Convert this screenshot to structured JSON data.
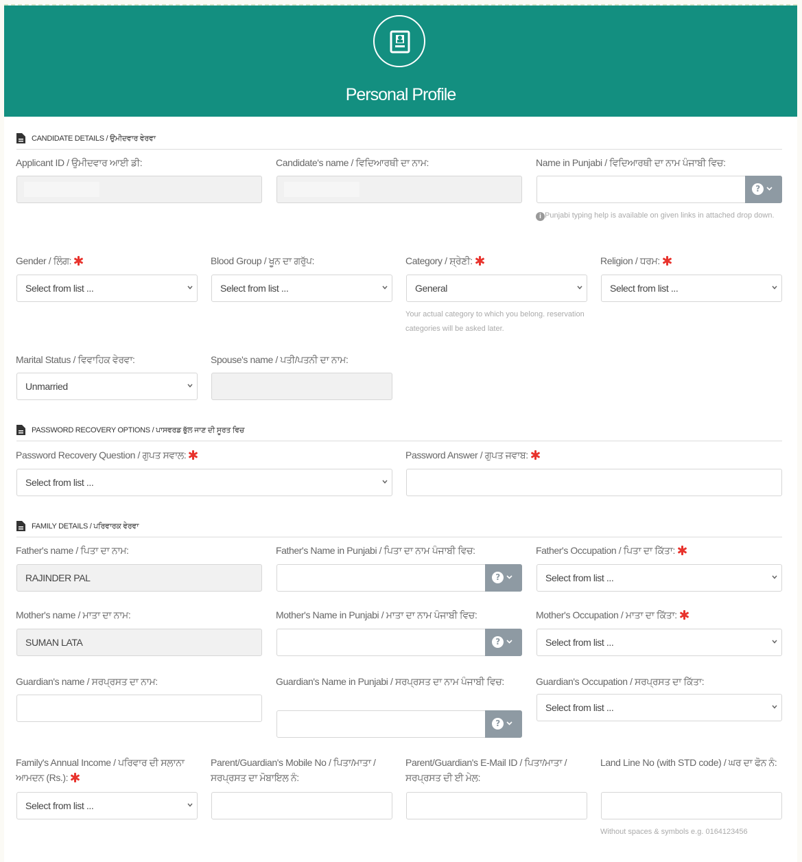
{
  "header": {
    "title": "Personal Profile",
    "icon": "profile-card-icon"
  },
  "candidate": {
    "section_title": "CANDIDATE DETAILS / ਉਮੀਦਵਾਰ ਵੇਰਵਾ",
    "applicant_id_label": "Applicant ID / ਉਮੀਦਵਾਰ ਆਈ ਡੀ:",
    "applicant_id_value": "",
    "candidate_name_label": "Candidate's name / ਵਿਦਿਆਰਥੀ ਦਾ ਨਾਮ:",
    "candidate_name_value": "",
    "punjabi_name_label": "Name in Punjabi / ਵਿਦਿਆਰਥੀ ਦਾ ਨਾਮ ਪੰਜਾਬੀ ਵਿਚ:",
    "punjabi_help_note": "Punjabi typing help is available on given links in attached drop down.",
    "gender_label": "Gender / ਲਿੰਗ:",
    "gender_value": "Select from list ...",
    "blood_group_label": "Blood Group / ਖੂਨ ਦਾ ਗਰੁੱਪ:",
    "blood_group_value": "Select from list ...",
    "category_label": "Category / ਸ਼੍ਰੇਣੀ:",
    "category_value": "General",
    "category_note": "Your actual category to which you belong. reservation categories will be asked later.",
    "religion_label": "Religion / ਧਰਮ:",
    "religion_value": "Select from list ...",
    "marital_label": "Marital Status / ਵਿਵਾਹਿਕ ਵੇਰਵਾ:",
    "marital_value": "Unmarried",
    "spouse_label": "Spouse's name / ਪਤੀ/ਪਤਨੀ ਦਾ ਨਾਮ:",
    "spouse_value": ""
  },
  "password": {
    "section_title": "PASSWORD RECOVERY OPTIONS / ਪਾਸਵਰਡ ਭੁੱਲ ਜਾਣ ਦੀ ਸੂਰਤ ਵਿਚ",
    "question_label": "Password Recovery Question / ਗੁਪਤ ਸਵਾਲ:",
    "question_value": "Select from list ...",
    "answer_label": "Password Answer / ਗੁਪਤ ਜਵਾਬ:",
    "answer_value": ""
  },
  "family": {
    "section_title": "FAMILY DETAILS / ਪਰਿਵਾਰਕ ਵੇਰਵਾ",
    "father_name_label": "Father's name / ਪਿਤਾ ਦਾ ਨਾਮ:",
    "father_name_value": "RAJINDER PAL",
    "father_punjabi_label": "Father's Name in Punjabi / ਪਿਤਾ ਦਾ ਨਾਮ ਪੰਜਾਬੀ ਵਿਚ:",
    "father_occupation_label": "Father's Occupation / ਪਿਤਾ ਦਾ ਕਿੱਤਾ:",
    "father_occupation_value": "Select from list ...",
    "mother_name_label": "Mother's name / ਮਾਤਾ ਦਾ ਨਾਮ:",
    "mother_name_value": "SUMAN LATA",
    "mother_punjabi_label": "Mother's Name in Punjabi / ਮਾਤਾ ਦਾ ਨਾਮ ਪੰਜਾਬੀ ਵਿਚ:",
    "mother_occupation_label": "Mother's Occupation / ਮਾਤਾ ਦਾ ਕਿੱਤਾ:",
    "mother_occupation_value": "Select from list ...",
    "guardian_name_label": "Guardian's name / ਸਰਪ੍ਰਸਤ ਦਾ ਨਾਮ:",
    "guardian_punjabi_label": "Guardian's Name in Punjabi / ਸਰਪ੍ਰਸਤ ਦਾ ਨਾਮ ਪੰਜਾਬੀ ਵਿਚ:",
    "guardian_occupation_label": "Guardian's Occupation / ਸਰਪ੍ਰਸਤ ਦਾ ਕਿੱਤਾ:",
    "guardian_occupation_value": "Select from list ...",
    "income_label": "Family's Annual Income / ਪਰਿਵਾਰ ਦੀ ਸਲਾਨਾ ਆਮਦਨ (Rs.):",
    "income_value": "Select from list ...",
    "mobile_label": "Parent/Guardian's Mobile No / ਪਿਤਾ/ਮਾਤਾ /ਸਰਪ੍ਰਸਤ ਦਾ ਮੋਬਾਇਲ ਨੰ:",
    "email_label": "Parent/Guardian's E-Mail ID / ਪਿਤਾ/ਮਾਤਾ /ਸਰਪ੍ਰਸਤ ਦੀ ਈ ਮੇਲ:",
    "landline_label": "Land Line No (with STD code) / ਘਰ ਦਾ ਫੋਨ ਨੰ:",
    "landline_note": "Without spaces & symbols e.g. 0164123456"
  },
  "colors": {
    "header_bg": "#138f80",
    "required": "#e8332d",
    "help_button": "#8e9aa3"
  }
}
